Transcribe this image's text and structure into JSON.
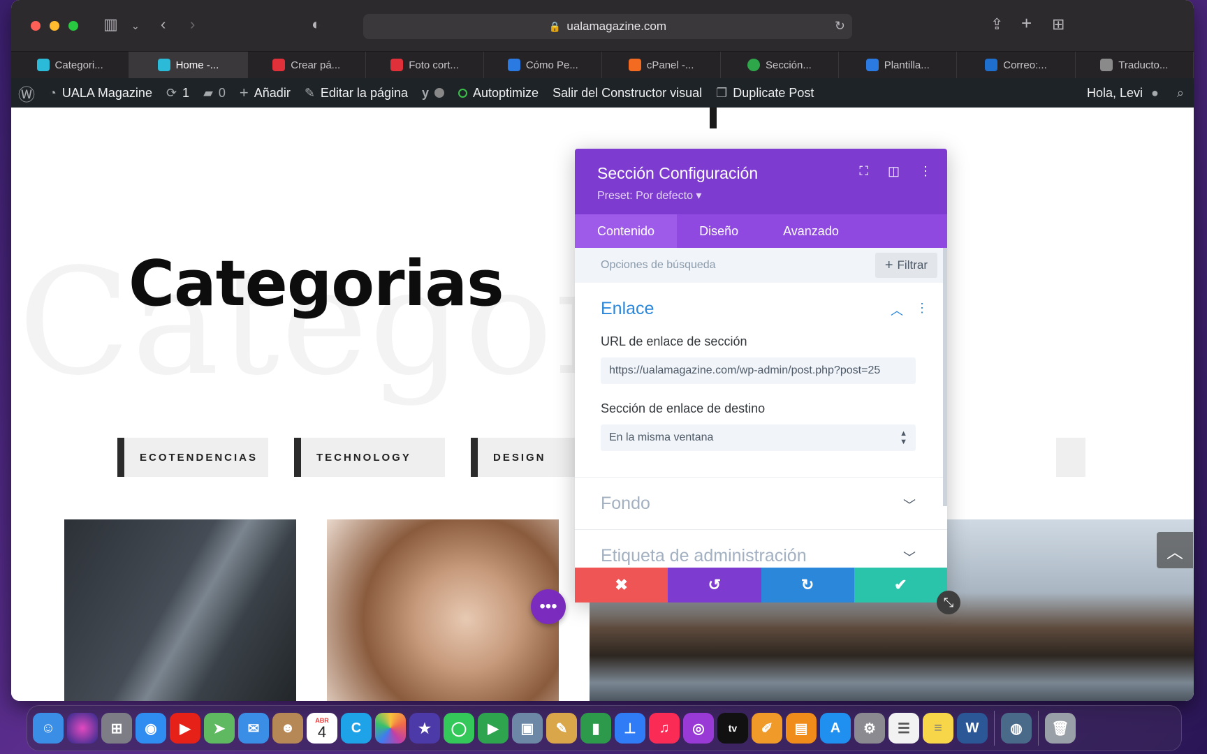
{
  "browser": {
    "url": "ualamagazine.com",
    "tabs": [
      {
        "label": "Categori...",
        "color": "#2bbbd9"
      },
      {
        "label": "Home -...",
        "color": "#2bbbd9",
        "active": true
      },
      {
        "label": "Crear pá...",
        "color": "#e0313a"
      },
      {
        "label": "Foto cort...",
        "color": "#e0313a"
      },
      {
        "label": "Cómo Pe...",
        "color": "#2a7ae2"
      },
      {
        "label": "cPanel -...",
        "color": "#f26b21"
      },
      {
        "label": "Sección...",
        "color": "#2ea74b"
      },
      {
        "label": "Plantilla...",
        "color": "#2a7ae2"
      },
      {
        "label": "Correo:...",
        "color": "#1f6fcf"
      },
      {
        "label": "Traducto...",
        "color": "#8a8a8a"
      }
    ]
  },
  "adminbar": {
    "site": "UALA Magazine",
    "updates": "1",
    "comments": "0",
    "add": "Añadir",
    "edit": "Editar la página",
    "autoptimize": "Autoptimize",
    "exit_builder": "Salir del Constructor visual",
    "duplicate": "Duplicate Post",
    "greeting": "Hola, Levi"
  },
  "page": {
    "title": "Categorias",
    "ghost_title": "Categorias",
    "categories": [
      "ECOTENDENCIAS",
      "TECHNOLOGY",
      "DESIGN"
    ]
  },
  "modal": {
    "title": "Sección Configuración",
    "preset": "Preset: Por defecto ▾",
    "tabs": [
      "Contenido",
      "Diseño",
      "Avanzado"
    ],
    "search_placeholder": "Opciones de búsqueda",
    "filter": "Filtrar",
    "section_link": "Enlace",
    "url_label": "URL de enlace de sección",
    "url_value": "https://ualamagazine.com/wp-admin/post.php?post=25",
    "target_label": "Sección de enlace de destino",
    "target_value": "En la misma ventana",
    "section_background": "Fondo",
    "section_admin_label": "Etiqueta de administración"
  },
  "colors": {
    "modal_header": "#7e3bd0",
    "modal_tabs": "#8f49e0",
    "cancel": "#ef5555",
    "undo": "#7e3bd0",
    "redo": "#2b87da",
    "save": "#29c4a9"
  },
  "dock": {
    "calendar_month": "ABR",
    "calendar_day": "4",
    "tv_label": "tv"
  }
}
